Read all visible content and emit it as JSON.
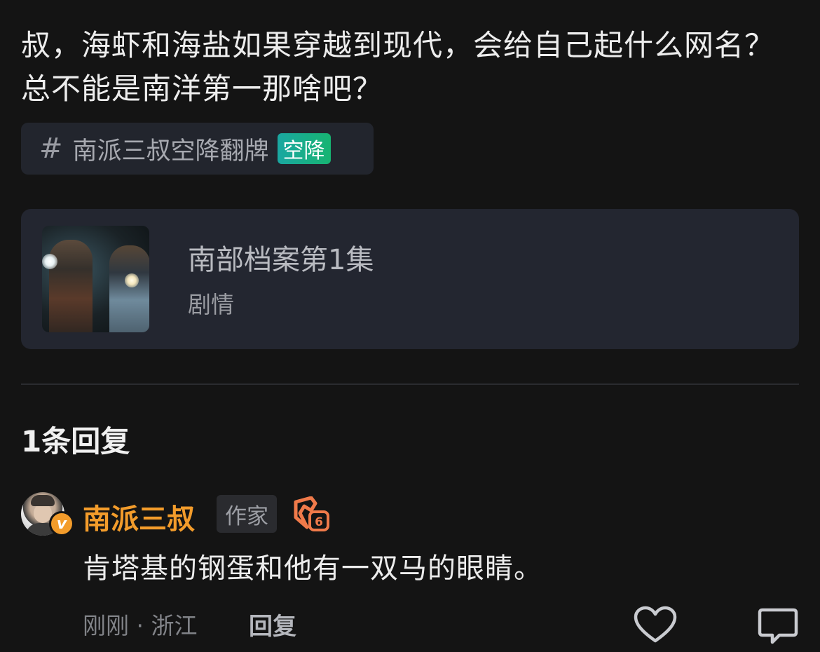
{
  "post": {
    "text": "叔，海虾和海盐如果穿越到现代，会给自己起什么网名？总不能是南洋第一那啥吧？"
  },
  "topic": {
    "hash": "#",
    "label": "南派三叔空降翻牌",
    "badge": "空降",
    "badge_colors": [
      "#1aa7a1",
      "#17b472"
    ]
  },
  "media_card": {
    "title": "南部档案第1集",
    "subtitle": "剧情"
  },
  "replies": {
    "count_label": "1条回复",
    "items": [
      {
        "author": "南派三叔",
        "verified_badge": "v",
        "tag": "作家",
        "level_icon": "level-badge-icon",
        "text": "肯塔基的钢蛋和他有一双马的眼睛。",
        "meta": "刚刚 · 浙江",
        "reply_label": "回复"
      }
    ]
  },
  "colors": {
    "background": "#141414",
    "author_accent": "#f39c2b",
    "card": "#232630"
  }
}
